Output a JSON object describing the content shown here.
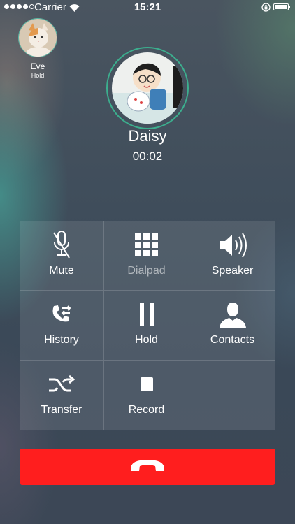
{
  "status_bar": {
    "carrier": "Carrier",
    "time": "15:21"
  },
  "hold_call": {
    "name": "Eve",
    "status": "Hold"
  },
  "active_call": {
    "name": "Daisy",
    "duration": "00:02"
  },
  "controls": [
    {
      "label": "Mute",
      "icon": "microphone-off-icon",
      "enabled": true
    },
    {
      "label": "Dialpad",
      "icon": "dialpad-icon",
      "enabled": false
    },
    {
      "label": "Speaker",
      "icon": "speaker-icon",
      "enabled": true
    },
    {
      "label": "History",
      "icon": "call-history-icon",
      "enabled": true
    },
    {
      "label": "Hold",
      "icon": "pause-icon",
      "enabled": true
    },
    {
      "label": "Contacts",
      "icon": "contacts-icon",
      "enabled": true
    },
    {
      "label": "Transfer",
      "icon": "transfer-icon",
      "enabled": true
    },
    {
      "label": "Record",
      "icon": "record-stop-icon",
      "enabled": true
    }
  ],
  "end_call": {
    "icon": "end-call-icon"
  },
  "colors": {
    "end_call": "#ff1e1e",
    "avatar_ring": "#3cae8e"
  }
}
